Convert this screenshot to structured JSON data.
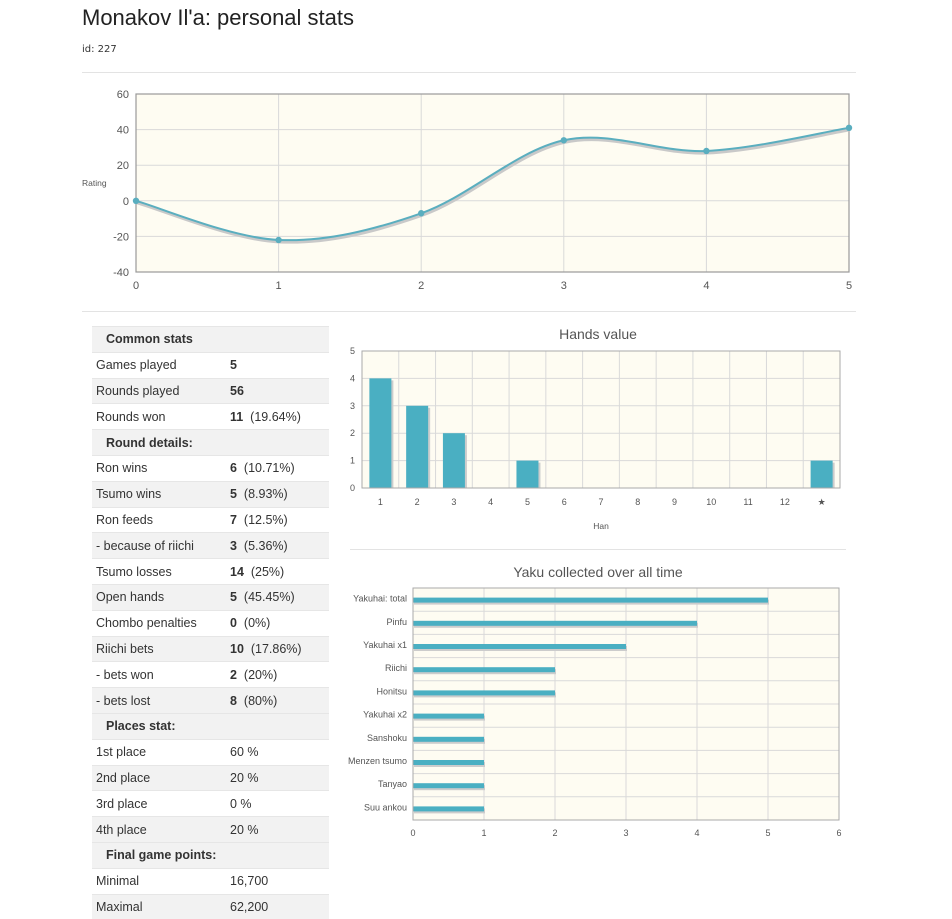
{
  "header": {
    "title": "Monakov Il'a: personal stats",
    "id_text": "id: 227"
  },
  "colors": {
    "line": "#5aaebf",
    "bar": "#4aafc2",
    "plot_bg": "#fefcf2",
    "grid": "#d9d9d9"
  },
  "stats_table": [
    {
      "type": "section",
      "label": "Common stats"
    },
    {
      "type": "row",
      "label": "Games played",
      "value": "5",
      "extra": ""
    },
    {
      "type": "row",
      "label": "Rounds played",
      "value": "56",
      "extra": ""
    },
    {
      "type": "row",
      "label": "Rounds won",
      "value": "11",
      "extra": "(19.64%)"
    },
    {
      "type": "section",
      "label": "Round details:"
    },
    {
      "type": "row",
      "label": "Ron wins",
      "value": "6",
      "extra": "(10.71%)"
    },
    {
      "type": "row",
      "label": "Tsumo wins",
      "value": "5",
      "extra": "(8.93%)"
    },
    {
      "type": "row",
      "label": "Ron feeds",
      "value": "7",
      "extra": "(12.5%)"
    },
    {
      "type": "row",
      "label": "- because of riichi",
      "value": "3",
      "extra": "(5.36%)"
    },
    {
      "type": "row",
      "label": "Tsumo losses",
      "value": "14",
      "extra": "(25%)"
    },
    {
      "type": "row",
      "label": "Open hands",
      "value": "5",
      "extra": "(45.45%)"
    },
    {
      "type": "row",
      "label": "Chombo penalties",
      "value": "0",
      "extra": "(0%)"
    },
    {
      "type": "row",
      "label": "Riichi bets",
      "value": "10",
      "extra": "(17.86%)"
    },
    {
      "type": "row",
      "label": "- bets won",
      "value": "2",
      "extra": "(20%)"
    },
    {
      "type": "row",
      "label": "- bets lost",
      "value": "8",
      "extra": "(80%)"
    },
    {
      "type": "section",
      "label": "Places stat:"
    },
    {
      "type": "row",
      "label": "1st place",
      "value": "",
      "extra": "60 %"
    },
    {
      "type": "row",
      "label": "2nd place",
      "value": "",
      "extra": "20 %"
    },
    {
      "type": "row",
      "label": "3rd place",
      "value": "",
      "extra": "0 %"
    },
    {
      "type": "row",
      "label": "4th place",
      "value": "",
      "extra": "20 %"
    },
    {
      "type": "section",
      "label": "Final game points:"
    },
    {
      "type": "row",
      "label": "Minimal",
      "value": "",
      "extra": "16,700"
    },
    {
      "type": "row",
      "label": "Maximal",
      "value": "",
      "extra": "62,200"
    }
  ],
  "chart_data": [
    {
      "type": "line",
      "title": "",
      "xlabel": "",
      "ylabel": "Rating",
      "x": [
        0,
        1,
        2,
        3,
        4,
        5
      ],
      "y": [
        0,
        -22,
        -7,
        34,
        28,
        41
      ],
      "xlim": [
        0,
        5
      ],
      "ylim": [
        -40,
        60
      ],
      "yticks": [
        -40,
        -20,
        0,
        20,
        40,
        60
      ],
      "xticks": [
        0,
        1,
        2,
        3,
        4,
        5
      ],
      "grid": true,
      "smooth": true
    },
    {
      "type": "bar",
      "title": "Hands value",
      "xlabel": "Han",
      "ylabel": "",
      "categories": [
        "1",
        "2",
        "3",
        "4",
        "5",
        "6",
        "7",
        "8",
        "9",
        "10",
        "11",
        "12",
        "★"
      ],
      "values": [
        4,
        3,
        2,
        0,
        1,
        0,
        0,
        0,
        0,
        0,
        0,
        0,
        1
      ],
      "ylim": [
        0,
        5
      ],
      "yticks": [
        0,
        1,
        2,
        3,
        4,
        5
      ],
      "grid": true
    },
    {
      "type": "bar",
      "orientation": "horizontal",
      "title": "Yaku collected over all time",
      "categories": [
        "Yakuhai: total",
        "Pinfu",
        "Yakuhai x1",
        "Riichi",
        "Honitsu",
        "Yakuhai x2",
        "Sanshoku",
        "Menzen tsumo",
        "Tanyao",
        "Suu ankou"
      ],
      "values": [
        5,
        4,
        3,
        2,
        2,
        1,
        1,
        1,
        1,
        1
      ],
      "xlim": [
        0,
        6
      ],
      "xticks": [
        0,
        1,
        2,
        3,
        4,
        5,
        6
      ],
      "grid": true
    }
  ]
}
